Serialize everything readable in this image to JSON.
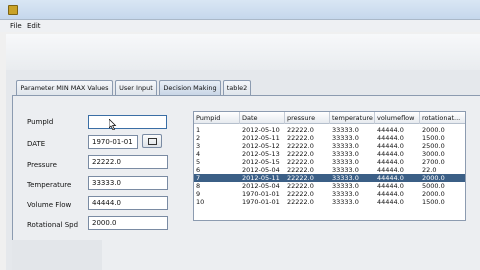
{
  "menu": {
    "file": "File",
    "edit": "Edit"
  },
  "tabs": [
    {
      "label": "Parameter MIN MAX Values"
    },
    {
      "label": "User Input"
    },
    {
      "label": "Decision Making"
    },
    {
      "label": "table2"
    }
  ],
  "form": {
    "pumpid": {
      "label": "PumpId",
      "value": ""
    },
    "date": {
      "label": "DATE",
      "value": "1970-01-01"
    },
    "pressure": {
      "label": "Pressure",
      "value": "22222.0"
    },
    "temperature": {
      "label": "Temperature",
      "value": "33333.0"
    },
    "volume_flow": {
      "label": "Volume Flow",
      "value": "44444.0"
    },
    "rotational_spd": {
      "label": "Rotational Spd",
      "value": "2000.0"
    }
  },
  "table": {
    "columns": [
      "Pumpid",
      "Date",
      "pressure",
      "temperature",
      "volumeflow",
      "rotationat..."
    ],
    "rows": [
      [
        "1",
        "2012-05-10",
        "22222.0",
        "33333.0",
        "44444.0",
        "2000.0"
      ],
      [
        "2",
        "2012-05-11",
        "22222.0",
        "33333.0",
        "44444.0",
        "1500.0"
      ],
      [
        "3",
        "2012-05-12",
        "22222.0",
        "33333.0",
        "44444.0",
        "2500.0"
      ],
      [
        "4",
        "2012-05-13",
        "22222.0",
        "33333.0",
        "44444.0",
        "3000.0"
      ],
      [
        "5",
        "2012-05-15",
        "22222.0",
        "33333.0",
        "44444.0",
        "2700.0"
      ],
      [
        "6",
        "2012-05-04",
        "22222.0",
        "33333.0",
        "44444.0",
        "22.0"
      ],
      [
        "7",
        "2012-05-11",
        "22222.0",
        "33333.0",
        "44444.0",
        "2000.0"
      ],
      [
        "8",
        "2012-05-04",
        "22222.0",
        "33333.0",
        "44444.0",
        "5000.0"
      ],
      [
        "9",
        "1970-01-01",
        "22222.0",
        "33333.0",
        "44444.0",
        "2000.0"
      ],
      [
        "10",
        "1970-01-01",
        "22222.0",
        "33333.0",
        "44444.0",
        "1500.0"
      ]
    ],
    "selected_row_index": 6
  },
  "colors": {
    "selection": "#3b5f86",
    "titlebar": "#c5d7ec"
  }
}
